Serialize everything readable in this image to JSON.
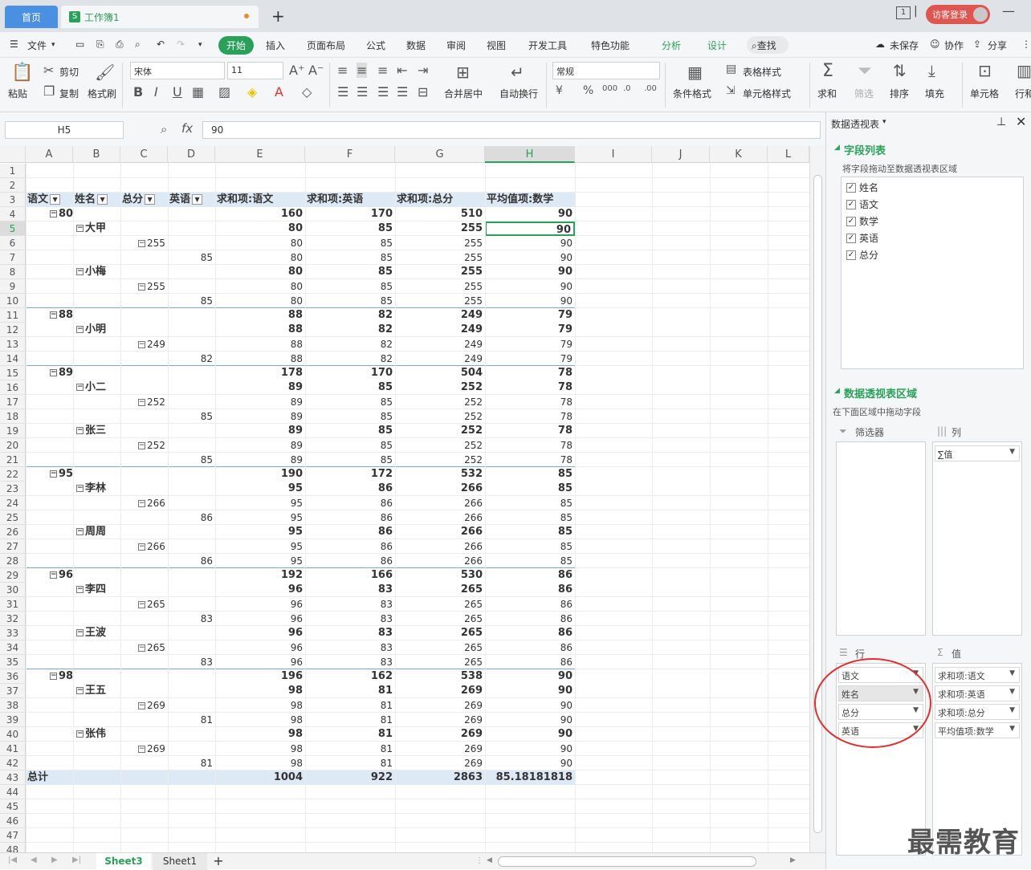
{
  "tabs": {
    "home": "首页",
    "workbook": "工作簿1",
    "new_tab": "+"
  },
  "titlebar": {
    "login": "访客登录",
    "tile_badge": "1"
  },
  "menu": {
    "file": "文件",
    "items": [
      "开始",
      "插入",
      "页面布局",
      "公式",
      "数据",
      "审阅",
      "视图",
      "开发工具",
      "特色功能"
    ],
    "pivot_tabs": [
      "分析",
      "设计"
    ],
    "search": "查找",
    "unsaved": "未保存",
    "collab": "协作",
    "share": "分享"
  },
  "toolbar": {
    "paste": "粘贴",
    "cut": "剪切",
    "copy": "复制",
    "format_painter": "格式刷",
    "font_name": "宋体",
    "font_size": "11",
    "merge_center": "合并居中",
    "auto_wrap": "自动换行",
    "number_format": "常规",
    "cond_format": "条件格式",
    "table_style": "表格样式",
    "cell_style": "单元格样式",
    "sum": "求和",
    "filter": "筛选",
    "sort": "排序",
    "fill": "填充",
    "cell": "单元格",
    "row_col": "行和"
  },
  "formula": {
    "name_box": "H5",
    "value": "90"
  },
  "columns": [
    "A",
    "B",
    "C",
    "D",
    "E",
    "F",
    "G",
    "H",
    "I",
    "J",
    "K",
    "L"
  ],
  "pivot": {
    "headers": [
      "语文",
      "姓名",
      "总分",
      "英语",
      "求和项:语文",
      "求和项:英语",
      "求和项:总分",
      "平均值项:数学"
    ],
    "rows": [
      {
        "r": "1"
      },
      {
        "r": "2"
      },
      {
        "r": "3",
        "header": true
      },
      {
        "r": "4",
        "a": "80",
        "level": 0,
        "e": "160",
        "f": "170",
        "g": "510",
        "h": "90"
      },
      {
        "r": "5",
        "b": "大甲",
        "level": 1,
        "e": "80",
        "f": "85",
        "g": "255",
        "h": "90"
      },
      {
        "r": "6",
        "c": "255",
        "level": 2,
        "e": "80",
        "f": "85",
        "g": "255",
        "h": "90"
      },
      {
        "r": "7",
        "d": "85",
        "level": 3,
        "e": "80",
        "f": "85",
        "g": "255",
        "h": "90"
      },
      {
        "r": "8",
        "b": "小梅",
        "level": 1,
        "e": "80",
        "f": "85",
        "g": "255",
        "h": "90"
      },
      {
        "r": "9",
        "c": "255",
        "level": 2,
        "e": "80",
        "f": "85",
        "g": "255",
        "h": "90"
      },
      {
        "r": "10",
        "d": "85",
        "level": 3,
        "e": "80",
        "f": "85",
        "g": "255",
        "h": "90"
      },
      {
        "r": "11",
        "a": "88",
        "level": 0,
        "e": "88",
        "f": "82",
        "g": "249",
        "h": "79"
      },
      {
        "r": "12",
        "b": "小明",
        "level": 1,
        "e": "88",
        "f": "82",
        "g": "249",
        "h": "79"
      },
      {
        "r": "13",
        "c": "249",
        "level": 2,
        "e": "88",
        "f": "82",
        "g": "249",
        "h": "79"
      },
      {
        "r": "14",
        "d": "82",
        "level": 3,
        "e": "88",
        "f": "82",
        "g": "249",
        "h": "79"
      },
      {
        "r": "15",
        "a": "89",
        "level": 0,
        "e": "178",
        "f": "170",
        "g": "504",
        "h": "78"
      },
      {
        "r": "16",
        "b": "小二",
        "level": 1,
        "e": "89",
        "f": "85",
        "g": "252",
        "h": "78"
      },
      {
        "r": "17",
        "c": "252",
        "level": 2,
        "e": "89",
        "f": "85",
        "g": "252",
        "h": "78"
      },
      {
        "r": "18",
        "d": "85",
        "level": 3,
        "e": "89",
        "f": "85",
        "g": "252",
        "h": "78"
      },
      {
        "r": "19",
        "b": "张三",
        "level": 1,
        "e": "89",
        "f": "85",
        "g": "252",
        "h": "78"
      },
      {
        "r": "20",
        "c": "252",
        "level": 2,
        "e": "89",
        "f": "85",
        "g": "252",
        "h": "78"
      },
      {
        "r": "21",
        "d": "85",
        "level": 3,
        "e": "89",
        "f": "85",
        "g": "252",
        "h": "78"
      },
      {
        "r": "22",
        "a": "95",
        "level": 0,
        "e": "190",
        "f": "172",
        "g": "532",
        "h": "85"
      },
      {
        "r": "23",
        "b": "李林",
        "level": 1,
        "e": "95",
        "f": "86",
        "g": "266",
        "h": "85"
      },
      {
        "r": "24",
        "c": "266",
        "level": 2,
        "e": "95",
        "f": "86",
        "g": "266",
        "h": "85"
      },
      {
        "r": "25",
        "d": "86",
        "level": 3,
        "e": "95",
        "f": "86",
        "g": "266",
        "h": "85"
      },
      {
        "r": "26",
        "b": "周周",
        "level": 1,
        "e": "95",
        "f": "86",
        "g": "266",
        "h": "85"
      },
      {
        "r": "27",
        "c": "266",
        "level": 2,
        "e": "95",
        "f": "86",
        "g": "266",
        "h": "85"
      },
      {
        "r": "28",
        "d": "86",
        "level": 3,
        "e": "95",
        "f": "86",
        "g": "266",
        "h": "85"
      },
      {
        "r": "29",
        "a": "96",
        "level": 0,
        "e": "192",
        "f": "166",
        "g": "530",
        "h": "86"
      },
      {
        "r": "30",
        "b": "李四",
        "level": 1,
        "e": "96",
        "f": "83",
        "g": "265",
        "h": "86"
      },
      {
        "r": "31",
        "c": "265",
        "level": 2,
        "e": "96",
        "f": "83",
        "g": "265",
        "h": "86"
      },
      {
        "r": "32",
        "d": "83",
        "level": 3,
        "e": "96",
        "f": "83",
        "g": "265",
        "h": "86"
      },
      {
        "r": "33",
        "b": "王波",
        "level": 1,
        "e": "96",
        "f": "83",
        "g": "265",
        "h": "86"
      },
      {
        "r": "34",
        "c": "265",
        "level": 2,
        "e": "96",
        "f": "83",
        "g": "265",
        "h": "86"
      },
      {
        "r": "35",
        "d": "83",
        "level": 3,
        "e": "96",
        "f": "83",
        "g": "265",
        "h": "86"
      },
      {
        "r": "36",
        "a": "98",
        "level": 0,
        "e": "196",
        "f": "162",
        "g": "538",
        "h": "90"
      },
      {
        "r": "37",
        "b": "王五",
        "level": 1,
        "e": "98",
        "f": "81",
        "g": "269",
        "h": "90"
      },
      {
        "r": "38",
        "c": "269",
        "level": 2,
        "e": "98",
        "f": "81",
        "g": "269",
        "h": "90"
      },
      {
        "r": "39",
        "d": "81",
        "level": 3,
        "e": "98",
        "f": "81",
        "g": "269",
        "h": "90"
      },
      {
        "r": "40",
        "b": "张伟",
        "level": 1,
        "e": "98",
        "f": "81",
        "g": "269",
        "h": "90"
      },
      {
        "r": "41",
        "c": "269",
        "level": 2,
        "e": "98",
        "f": "81",
        "g": "269",
        "h": "90"
      },
      {
        "r": "42",
        "d": "81",
        "level": 3,
        "e": "98",
        "f": "81",
        "g": "269",
        "h": "90"
      },
      {
        "r": "43",
        "a": "总计",
        "total": true,
        "e": "1004",
        "f": "922",
        "g": "2863",
        "h": "85.18181818"
      },
      {
        "r": "44"
      },
      {
        "r": "45"
      },
      {
        "r": "46"
      },
      {
        "r": "47"
      },
      {
        "r": "48"
      }
    ]
  },
  "sheets": {
    "active": "Sheet3",
    "other": "Sheet1",
    "add": "+"
  },
  "panel": {
    "title": "数据透视表",
    "field_list_title": "字段列表",
    "field_list_hint": "将字段拖动至数据透视表区域",
    "fields": [
      "姓名",
      "语文",
      "数学",
      "英语",
      "总分"
    ],
    "area_title": "数据透视表区域",
    "area_hint": "在下面区域中拖动字段",
    "filter_label": "筛选器",
    "col_label": "列",
    "row_label": "行",
    "value_label": "值",
    "col_items": [
      "∑值"
    ],
    "row_items": [
      "语文",
      "姓名",
      "总分",
      "英语"
    ],
    "value_items": [
      "求和项:语文",
      "求和项:英语",
      "求和项:总分",
      "平均值项:数学"
    ]
  },
  "watermark": "最需教育",
  "colors": {
    "accent": "#2aa15a",
    "highlight": "#e12d2d",
    "selection": "#2aa15a",
    "tab_blue": "#4a90e2"
  }
}
